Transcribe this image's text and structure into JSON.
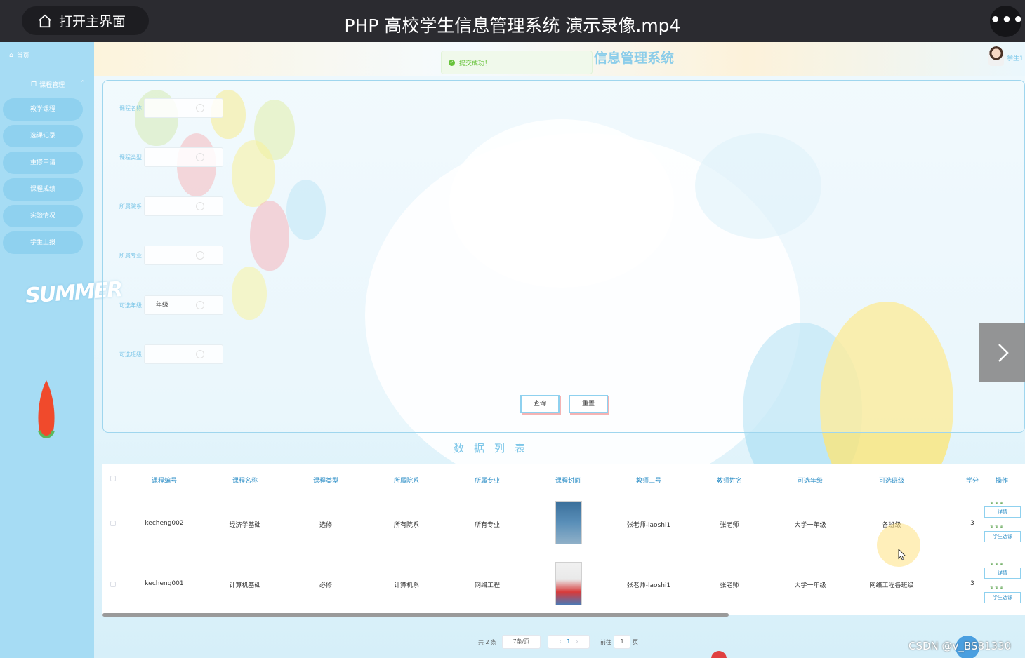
{
  "player": {
    "home_label": "打开主界面",
    "title": "PHP 高校学生信息管理系统 演示录像.mp4",
    "more_label": "•••"
  },
  "app": {
    "system_title": "信息管理系统",
    "toast": "提交成功！",
    "user": "学生1"
  },
  "sidebar": {
    "home": "首页",
    "group": "课程管理",
    "items": [
      {
        "label": "教学课程"
      },
      {
        "label": "选课记录"
      },
      {
        "label": "重修申请"
      },
      {
        "label": "课程成绩"
      },
      {
        "label": "实验情况"
      },
      {
        "label": "学生上报"
      }
    ],
    "deco_text": "SUMMER"
  },
  "search": {
    "fields": [
      {
        "label": "课程名称",
        "value": ""
      },
      {
        "label": "课程类型",
        "value": ""
      },
      {
        "label": "所属院系",
        "value": ""
      },
      {
        "label": "所属专业",
        "value": ""
      },
      {
        "label": "可选年级",
        "value": "一年级"
      },
      {
        "label": "可选班级",
        "value": ""
      }
    ],
    "query_label": "查询",
    "reset_label": "重置"
  },
  "list_title": "数据列表",
  "table": {
    "columns": [
      "课程编号",
      "课程名称",
      "课程类型",
      "所属院系",
      "所属专业",
      "课程封面",
      "教师工号",
      "教师姓名",
      "可选年级",
      "可选班级",
      "学分",
      "操作"
    ],
    "rows": [
      {
        "code": "kecheng002",
        "name": "经济学基础",
        "type": "选修",
        "dept": "所有院系",
        "major": "所有专业",
        "teacher_id": "张老师-laoshi1",
        "teacher": "张老师",
        "grade": "大学一年级",
        "class": "各班级",
        "credit": "3",
        "detail": "详情",
        "select": "学生选课"
      },
      {
        "code": "kecheng001",
        "name": "计算机基础",
        "type": "必修",
        "dept": "计算机系",
        "major": "网络工程",
        "teacher_id": "张老师-laoshi1",
        "teacher": "张老师",
        "grade": "大学一年级",
        "class": "网络工程各班级",
        "credit": "3",
        "detail": "详情",
        "select": "学生选课"
      }
    ]
  },
  "pagination": {
    "total": "共 2 条",
    "page_size": "7条/页",
    "current": "1",
    "goto_label": "前往",
    "goto_value": "1",
    "page_suffix": "页"
  },
  "watermark": "CSDN @v_BS81330",
  "colors": {
    "sidebar": "#a6dcf4",
    "accent": "#2e8fc7",
    "success": "#67c23a"
  }
}
